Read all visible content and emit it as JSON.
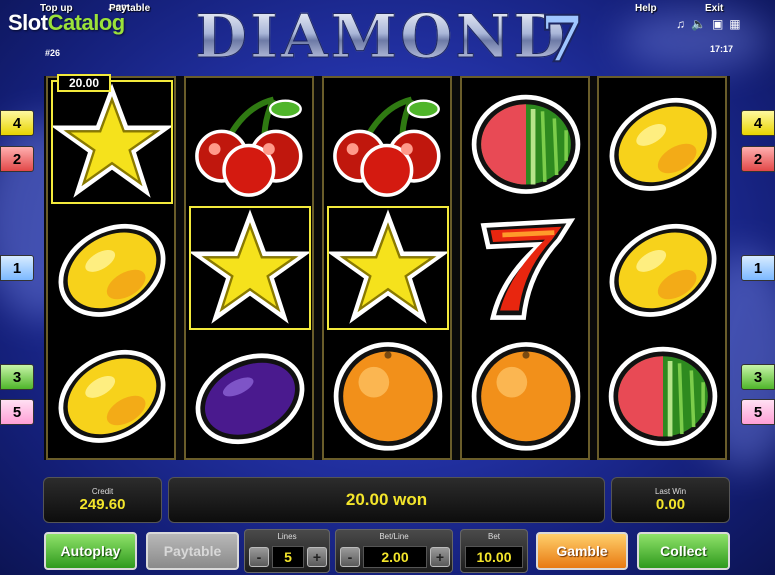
{
  "watermark": {
    "brand_a": "Slot",
    "brand_b": "Catalog",
    "suffix": ".com"
  },
  "top_menu": {
    "top_up": "Top up",
    "paytable": "Paytable",
    "help": "Help",
    "exit": "Exit"
  },
  "game_number": "#26",
  "logo": {
    "title": "DIAMOND",
    "seven": "7"
  },
  "utility_icons": [
    "music-icon",
    "sound-icon",
    "settings-icon",
    "fullscreen-icon"
  ],
  "clock": "17:17",
  "win_badge": "20.00",
  "reels": [
    [
      "star",
      "lemon",
      "lemon"
    ],
    [
      "cherry",
      "star",
      "plum"
    ],
    [
      "cherry",
      "star",
      "orange"
    ],
    [
      "watermelon",
      "seven",
      "orange"
    ],
    [
      "lemon",
      "lemon",
      "watermelon"
    ]
  ],
  "winning_cells": [
    [
      0,
      0
    ],
    [
      1,
      1
    ],
    [
      2,
      1
    ]
  ],
  "line_markers": {
    "left": [
      {
        "label": "4",
        "color": "#e8d400"
      },
      {
        "label": "2",
        "color": "#e24848"
      },
      {
        "label": "1",
        "color": "#7cb8ff"
      },
      {
        "label": "3",
        "color": "#4fb52a"
      },
      {
        "label": "5",
        "color": "#ff9fd6"
      }
    ],
    "right": [
      {
        "label": "4",
        "color": "#e8d400"
      },
      {
        "label": "2",
        "color": "#e24848"
      },
      {
        "label": "1",
        "color": "#7cb8ff"
      },
      {
        "label": "3",
        "color": "#4fb52a"
      },
      {
        "label": "5",
        "color": "#ff9fd6"
      }
    ]
  },
  "info": {
    "credit_label": "Credit",
    "credit_value": "249.60",
    "status": "20.00 won",
    "last_win_label": "Last Win",
    "last_win_value": "0.00"
  },
  "controls": {
    "autoplay": "Autoplay",
    "paytable": "Paytable",
    "lines_label": "Lines",
    "lines_value": "5",
    "betline_label": "Bet/Line",
    "betline_value": "2.00",
    "bet_label": "Bet",
    "bet_value": "10.00",
    "minus": "-",
    "plus": "+",
    "gamble": "Gamble",
    "collect": "Collect"
  }
}
